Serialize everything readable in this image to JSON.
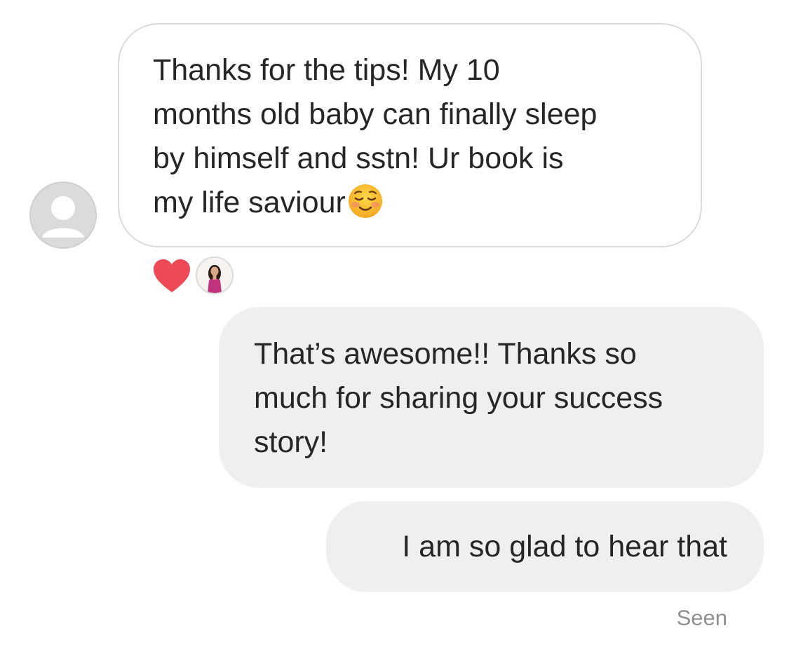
{
  "thread": {
    "incoming_message": {
      "lines": [
        "Thanks for the tips! My 10",
        "months old baby can finally sleep",
        "by himself and sstn! Ur book is",
        "my life saviour"
      ],
      "emoji": "smiling-face-icon",
      "reaction": {
        "icon": "heart-icon",
        "color": "#ed4956"
      }
    },
    "outgoing_messages": [
      {
        "lines": [
          "That’s awesome!! Thanks so",
          "much for sharing your success",
          "story!"
        ]
      },
      {
        "lines": [
          "I am so glad to hear that"
        ]
      }
    ],
    "status": "Seen"
  },
  "colors": {
    "incoming_border": "#dbdbdb",
    "outgoing_bubble": "#efefef",
    "text": "#262626",
    "status_text": "#8e8e8e"
  }
}
